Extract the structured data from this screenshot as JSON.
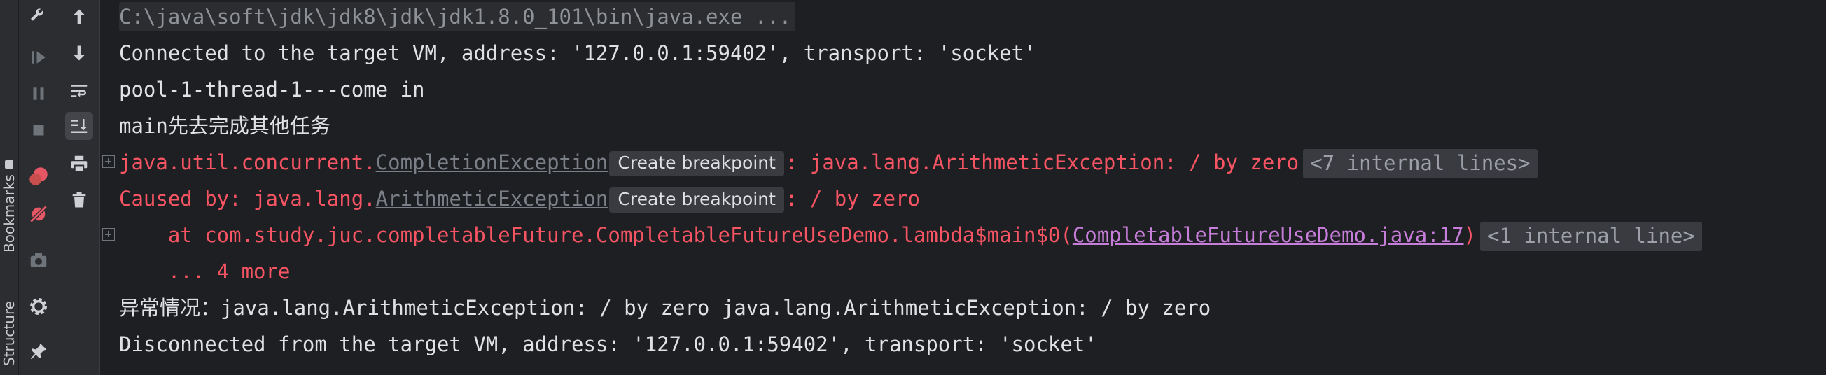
{
  "side_tabs": {
    "bookmarks": "Bookmarks",
    "structure": "Structure"
  },
  "tool_icons": [
    "wrench-icon",
    "resume-icon",
    "pause-icon",
    "stop-icon",
    "view-breakpoints-icon",
    "mute-breakpoints-icon",
    "camera-icon",
    "settings-icon",
    "pin-icon"
  ],
  "console_tool_icons": [
    "arrow-up-icon",
    "arrow-down-icon",
    "soft-wrap-icon",
    "scroll-to-end-icon",
    "print-icon",
    "trash-icon"
  ],
  "console": {
    "cmd": "C:\\java\\soft\\jdk\\jdk8\\jdk\\jdk1.8.0_101\\bin\\java.exe ...",
    "connected": "Connected to the target VM, address: '127.0.0.1:59402', transport: 'socket'",
    "thread_line": "pool-1-thread-1---come in",
    "main_line": "main先去完成其他任务",
    "exc1": {
      "prefix": "java.util.concurrent.",
      "link": "CompletionException",
      "bp": "Create breakpoint",
      "suffix": ": java.lang.ArithmeticException: / by zero",
      "internal": "<7 internal lines>"
    },
    "exc2": {
      "prefix": "Caused by: java.lang.",
      "link": "ArithmeticException",
      "bp": "Create breakpoint",
      "suffix": ": / by zero"
    },
    "stack": {
      "prefix": "    at com.study.juc.completableFuture.CompletableFutureUseDemo.lambda$main$0(",
      "link": "CompletableFutureUseDemo.java:17",
      "suffix": ")",
      "internal": "<1 internal line>"
    },
    "more": "    ... 4 more",
    "abnormal": "异常情况：java.lang.ArithmeticException: / by zero java.lang.ArithmeticException: / by zero",
    "disconnected": "Disconnected from the target VM, address: '127.0.0.1:59402', transport: 'socket'"
  },
  "colors": {
    "background": "#1e1f22",
    "text": "#dfe1e5",
    "error": "#f75464",
    "link": "#c77dda"
  }
}
